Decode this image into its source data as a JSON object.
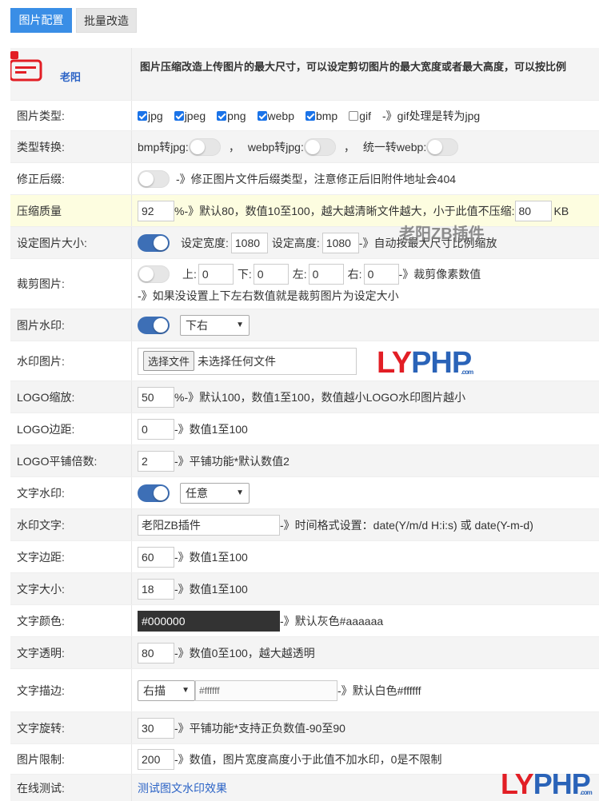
{
  "tabs": [
    {
      "label": "图片配置",
      "active": true
    },
    {
      "label": "批量改造",
      "active": false
    }
  ],
  "header": {
    "author": "老阳",
    "description": "图片压缩改造上传图片的最大尺寸，可以设定剪切图片的最大宽度或者最大高度，可以按比例"
  },
  "rows": {
    "img_type": {
      "label": "图片类型:",
      "types": [
        "jpg",
        "jpeg",
        "png",
        "webp",
        "bmp",
        "gif"
      ],
      "checked": [
        true,
        true,
        true,
        true,
        true,
        false
      ],
      "note": "-》gif处理是转为jpg"
    },
    "convert": {
      "label": "类型转换:",
      "bmp": "bmp转jpg:",
      "sep1": "，",
      "webp": "webp转jpg:",
      "sep2": "，",
      "all": "统一转webp:"
    },
    "suffix": {
      "label": "修正后缀:",
      "note": "-》修正图片文件后缀类型，注意修正后旧附件地址会404"
    },
    "quality": {
      "label": "压缩质量",
      "value": "92",
      "note": "%-》默认80，数值10至100，越大越清晰文件越大，小于此值不压缩:",
      "min": "80",
      "unit": "KB"
    },
    "size": {
      "label": "设定图片大小:",
      "w_label": "设定宽度:",
      "w": "1080",
      "h_label": "设定高度:",
      "h": "1080",
      "note": "-》自动按最大尺寸比例缩放"
    },
    "crop": {
      "label": "裁剪图片:",
      "top": "上:",
      "top_v": "0",
      "bottom": "下:",
      "bottom_v": "0",
      "left": "左:",
      "left_v": "0",
      "right": "右:",
      "right_v": "0",
      "note": "-》裁剪像素数值",
      "note2": "-》如果没设置上下左右数值就是裁剪图片为设定大小"
    },
    "watermark": {
      "label": "图片水印:",
      "position": "下右"
    },
    "wm_image": {
      "label": "水印图片:",
      "button": "选择文件",
      "status": "未选择任何文件"
    },
    "logo_scale": {
      "label": "LOGO缩放:",
      "value": "50",
      "note": "%-》默认100，数值1至100，数值越小LOGO水印图片越小"
    },
    "logo_margin": {
      "label": "LOGO边距:",
      "value": "0",
      "note": "-》数值1至100"
    },
    "logo_tile": {
      "label": "LOGO平铺倍数:",
      "value": "2",
      "note": "-》平铺功能*默认数值2"
    },
    "text_wm": {
      "label": "文字水印:",
      "position": "任意"
    },
    "wm_text": {
      "label": "水印文字:",
      "value": "老阳ZB插件",
      "note": "-》时间格式设置：date(Y/m/d H:i:s) 或 date(Y-m-d)"
    },
    "text_margin": {
      "label": "文字边距:",
      "value": "60",
      "note": "-》数值1至100"
    },
    "text_size": {
      "label": "文字大小:",
      "value": "18",
      "note": "-》数值1至100"
    },
    "text_color": {
      "label": "文字颜色:",
      "value": "#000000",
      "note": "-》默认灰色#aaaaaa"
    },
    "text_opacity": {
      "label": "文字透明:",
      "value": "80",
      "note": "-》数值0至100，越大越透明"
    },
    "text_stroke": {
      "label": "文字描边:",
      "mode": "右描",
      "color": "#ffffff",
      "note": "-》默认白色#ffffff"
    },
    "text_rotate": {
      "label": "文字旋转:",
      "value": "30",
      "note": "-》平铺功能*支持正负数值-90至90"
    },
    "img_limit": {
      "label": "图片限制:",
      "value": "200",
      "note": "-》数值，图片宽度高度小于此值不加水印，0是不限制"
    },
    "online_test": {
      "label": "在线测试:",
      "link": "测试图文水印效果"
    }
  },
  "watermark_overlay": "老阳ZB插件",
  "logo": {
    "ly": "LY",
    "php": "PHP",
    "com": ".com"
  },
  "colors": {
    "accent": "#3a8ee6",
    "toggle_on": "#3d6fb6",
    "link": "#2b63c6",
    "highlight": "#fdfde0"
  }
}
